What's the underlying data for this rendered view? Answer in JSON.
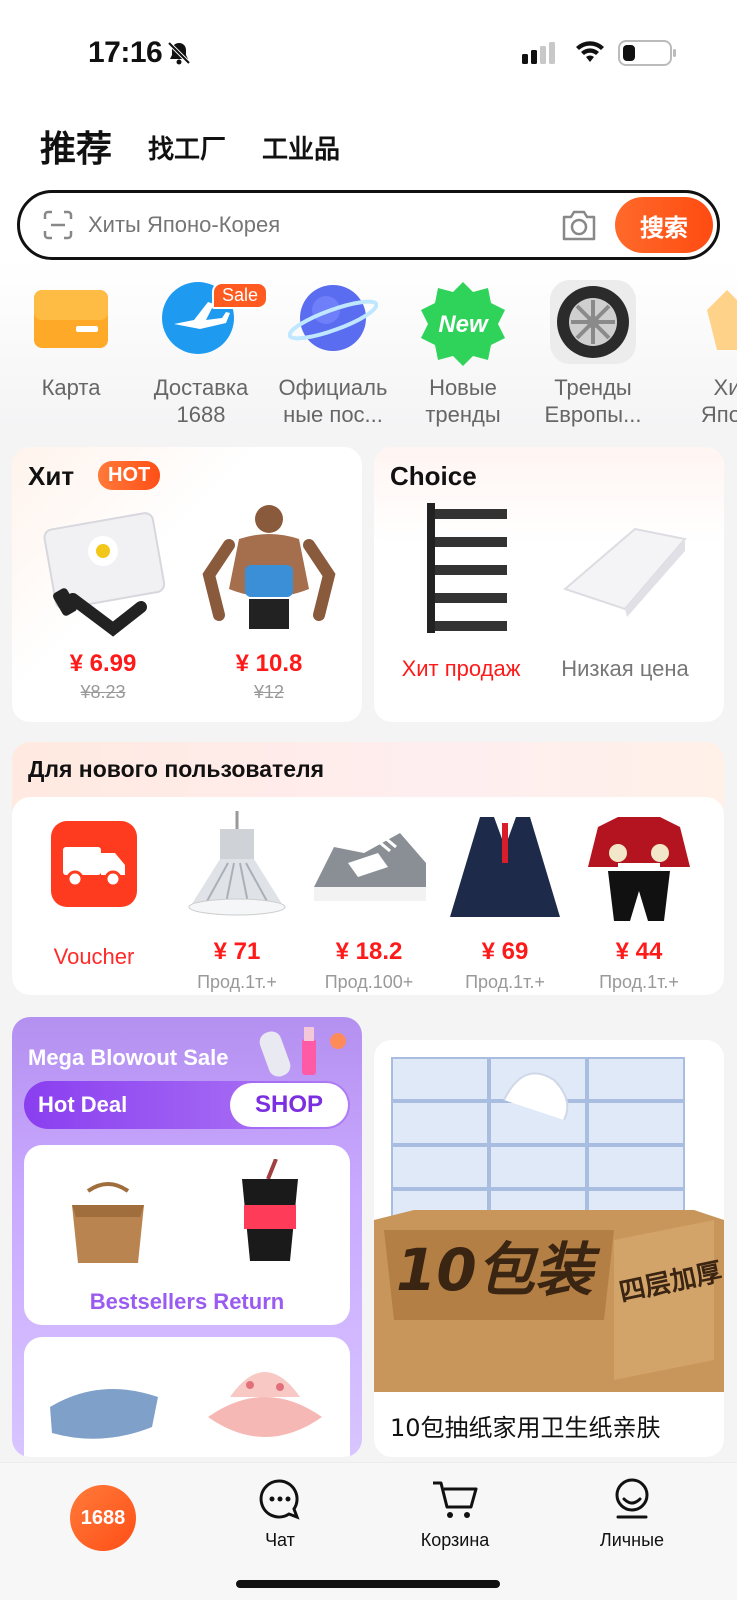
{
  "status_bar": {
    "time": "17:16"
  },
  "top_tabs": [
    {
      "label": "推荐"
    },
    {
      "label": "找工厂"
    },
    {
      "label": "工业品"
    }
  ],
  "search": {
    "placeholder": "Хиты Японо-Корея",
    "button": "搜索"
  },
  "categories": [
    {
      "label1": "Карта",
      "label2": "",
      "icon": "card-icon"
    },
    {
      "label1": "Доставка",
      "label2": "1688",
      "icon": "plane-icon",
      "badge": "Sale"
    },
    {
      "label1": "Официаль",
      "label2": "ные пос...",
      "icon": "planet-icon"
    },
    {
      "label1": "Новые",
      "label2": "тренды",
      "icon": "new-badge-icon",
      "icon_text": "New"
    },
    {
      "label1": "Тренды",
      "label2": "Европы...",
      "icon": "tire-icon"
    },
    {
      "label1": "Хи",
      "label2": "Япон",
      "icon": "partial-icon"
    }
  ],
  "hot": {
    "title": "Хит",
    "badge": "HOT",
    "products": [
      {
        "price": "¥ 6.99",
        "old_price": "¥8.23",
        "image": "umbrella"
      },
      {
        "price": "¥ 10.8",
        "old_price": "¥12",
        "image": "fitness-belt"
      }
    ]
  },
  "choice": {
    "title": "Choice",
    "items": [
      {
        "label": "Хит продаж",
        "image": "shelf"
      },
      {
        "label": "Низкая цена",
        "image": "tray"
      }
    ]
  },
  "new_user": {
    "title": "Для нового пользователя",
    "voucher_label": "Voucher",
    "items": [
      {
        "price": "¥ 71",
        "sub": "Прод.1т.+",
        "image": "lamp"
      },
      {
        "price": "¥ 18.2",
        "sub": "Прод.100+",
        "image": "sneaker"
      },
      {
        "price": "¥ 69",
        "sub": "Прод.1т.+",
        "image": "uniform"
      },
      {
        "price": "¥ 44",
        "sub": "Прод.1т.+",
        "image": "kids-outfit"
      }
    ]
  },
  "mega": {
    "title": "Mega Blowout Sale",
    "hot_deal": "Hot Deal",
    "shop": "SHOP",
    "panel_title": "Bestsellers Return"
  },
  "tissue": {
    "title": "10包抽纸家用卫生纸亲肤",
    "box_text": "10包装",
    "side_text": "四层加厚"
  },
  "bottom_nav": {
    "home": "1688",
    "chat": "Чат",
    "cart": "Корзина",
    "profile": "Личные"
  },
  "colors": {
    "accent": "#ff5a1f",
    "price": "#ff1a1a",
    "purple": "#9a5cf0"
  }
}
